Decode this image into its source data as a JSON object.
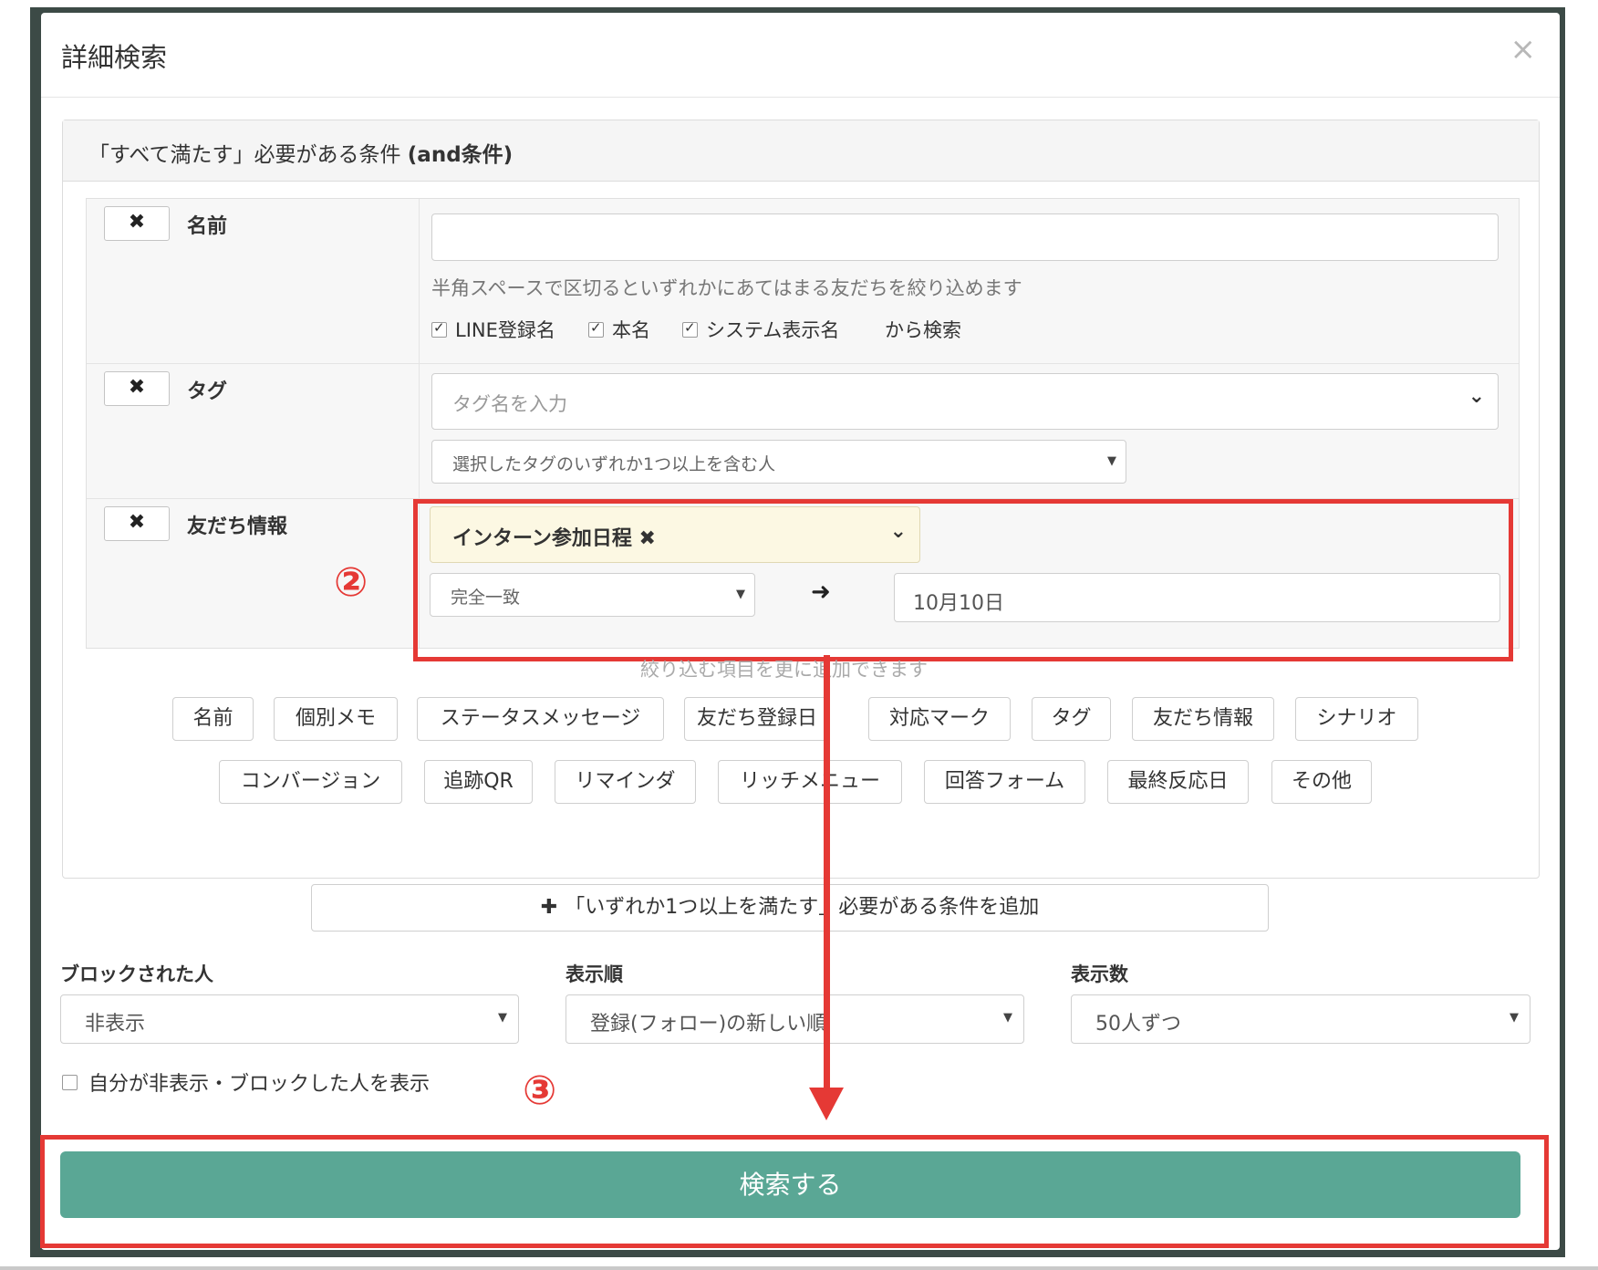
{
  "modal": {
    "title": "詳細検索",
    "close": "×"
  },
  "and_panel": {
    "heading_prefix": "「すべて満たす」必要がある条件 ",
    "heading_bold": "(and条件)"
  },
  "conditions": {
    "remove_label": "✖",
    "name": {
      "label": "名前",
      "input_value": "",
      "hint": "半角スペースで区切るといずれかにあてはまる友だちを絞り込めます",
      "checkboxes": [
        {
          "label": "LINE登録名",
          "checked": true
        },
        {
          "label": "本名",
          "checked": true
        },
        {
          "label": "システム表示名",
          "checked": true
        }
      ],
      "suffix": "から検索"
    },
    "tag": {
      "label": "タグ",
      "placeholder": "タグ名を入力",
      "mode": "選択したタグのいずれか1つ以上を含む人"
    },
    "friend_info": {
      "label": "友だち情報",
      "field": "インターン参加日程 ✖",
      "match": "完全一致",
      "arrow": "➜",
      "value": "10月10日"
    }
  },
  "annotations": {
    "step2": "②",
    "step3": "③",
    "accent_color": "#e53935"
  },
  "more_hint": "絞り込む項目を更に追加できます",
  "add_buttons_row1": [
    "名前",
    "個別メモ",
    "ステータスメッセージ",
    "友だち登録日",
    "対応マーク",
    "タグ",
    "友だち情報",
    "シナリオ"
  ],
  "add_buttons_row2": [
    "コンバージョン",
    "追跡QR",
    "リマインダ",
    "リッチメニュー",
    "回答フォーム",
    "最終反応日",
    "その他"
  ],
  "or_button": {
    "icon": "✚",
    "label": "「いずれか1つ以上を満たす」必要がある条件を追加"
  },
  "filters": {
    "blocked": {
      "label": "ブロックされた人",
      "value": "非表示"
    },
    "order": {
      "label": "表示順",
      "value": "登録(フォロー)の新しい順"
    },
    "count": {
      "label": "表示数",
      "value": "50人ずつ"
    }
  },
  "show_hidden": {
    "label": "自分が非表示・ブロックした人を表示",
    "checked": false
  },
  "search_button": {
    "label": "検索する",
    "color": "#5aa795"
  }
}
